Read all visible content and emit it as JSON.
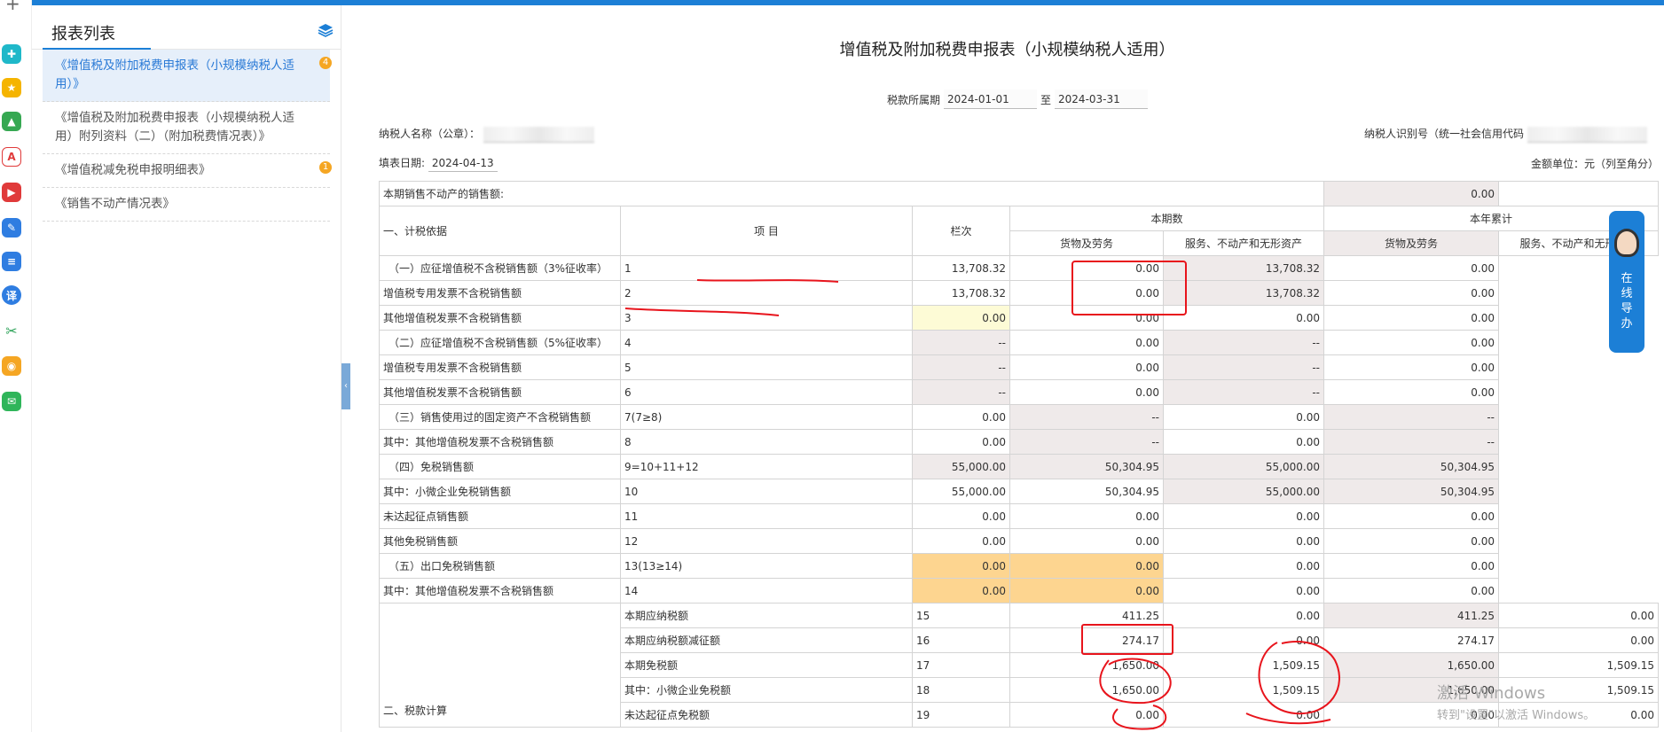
{
  "sidebar": {
    "title": "报表列表",
    "items": [
      {
        "label": "《增值税及附加税费申报表（小规模纳税人适用）》",
        "badge": "4"
      },
      {
        "label": "《增值税及附加税费申报表（小规模纳税人适用）附列资料（二）（附加税费情况表）》",
        "badge": ""
      },
      {
        "label": "《增值税减免税申报明细表》",
        "badge": "1"
      },
      {
        "label": "《销售不动产情况表》",
        "badge": ""
      }
    ]
  },
  "form": {
    "title": "增值税及附加税费申报表（小规模纳税人适用）",
    "period_label": "税款所属期",
    "period_from": "2024-01-01",
    "period_sep": "至",
    "period_to": "2024-03-31",
    "taxpayer_name_label": "纳税人名称（公章）：",
    "taxpayer_id_label": "纳税人识别号（统一社会信用代码",
    "fill_date_label": "填表日期:",
    "fill_date": "2024-04-13",
    "unit_label": "金额单位：元（列至角分）"
  },
  "table": {
    "row0_label": "本期销售不动产的销售额:",
    "row0_value": "0.00",
    "h_item": "项  目",
    "h_col": "栏次",
    "h_current": "本期数",
    "h_ytd": "本年累计",
    "h_goods": "货物及劳务",
    "h_services": "服务、不动产和无形资产",
    "section1": "一、计税依据",
    "section2": "二、税款计算",
    "rows": [
      {
        "label": "（一）应征增值税不含税销售额（3%征收率）",
        "col": "1",
        "c1": "13,708.32",
        "c2": "0.00",
        "y1": "13,708.32",
        "y2": "0.00"
      },
      {
        "label": "增值税专用发票不含税销售额",
        "col": "2",
        "c1": "13,708.32",
        "c2": "0.00",
        "y1": "13,708.32",
        "y2": "0.00"
      },
      {
        "label": "其他增值税发票不含税销售额",
        "col": "3",
        "c1": "0.00",
        "c2": "0.00",
        "y1": "0.00",
        "y2": "0.00"
      },
      {
        "label": "（二）应征增值税不含税销售额（5%征收率）",
        "col": "4",
        "c1": "--",
        "c2": "0.00",
        "y1": "--",
        "y2": "0.00"
      },
      {
        "label": "增值税专用发票不含税销售额",
        "col": "5",
        "c1": "--",
        "c2": "0.00",
        "y1": "--",
        "y2": "0.00"
      },
      {
        "label": "其他增值税发票不含税销售额",
        "col": "6",
        "c1": "--",
        "c2": "0.00",
        "y1": "--",
        "y2": "0.00"
      },
      {
        "label": "（三）销售使用过的固定资产不含税销售额",
        "col": "7(7≥8)",
        "c1": "0.00",
        "c2": "--",
        "y1": "0.00",
        "y2": "--"
      },
      {
        "label": "其中：其他增值税发票不含税销售额",
        "col": "8",
        "c1": "0.00",
        "c2": "--",
        "y1": "0.00",
        "y2": "--"
      },
      {
        "label": "（四）免税销售额",
        "col": "9=10+11+12",
        "c1": "55,000.00",
        "c2": "50,304.95",
        "y1": "55,000.00",
        "y2": "50,304.95"
      },
      {
        "label": "其中：小微企业免税销售额",
        "col": "10",
        "c1": "55,000.00",
        "c2": "50,304.95",
        "y1": "55,000.00",
        "y2": "50,304.95"
      },
      {
        "label": "未达起征点销售额",
        "col": "11",
        "c1": "0.00",
        "c2": "0.00",
        "y1": "0.00",
        "y2": "0.00"
      },
      {
        "label": "其他免税销售额",
        "col": "12",
        "c1": "0.00",
        "c2": "0.00",
        "y1": "0.00",
        "y2": "0.00"
      },
      {
        "label": "（五）出口免税销售额",
        "col": "13(13≥14)",
        "c1": "0.00",
        "c2": "0.00",
        "y1": "0.00",
        "y2": "0.00"
      },
      {
        "label": "其中：其他增值税发票不含税销售额",
        "col": "14",
        "c1": "0.00",
        "c2": "0.00",
        "y1": "0.00",
        "y2": "0.00"
      },
      {
        "label": "本期应纳税额",
        "col": "15",
        "c1": "411.25",
        "c2": "0.00",
        "y1": "411.25",
        "y2": "0.00"
      },
      {
        "label": "本期应纳税额减征额",
        "col": "16",
        "c1": "274.17",
        "c2": "0.00",
        "y1": "274.17",
        "y2": "0.00"
      },
      {
        "label": "本期免税额",
        "col": "17",
        "c1": "1,650.00",
        "c2": "1,509.15",
        "y1": "1,650.00",
        "y2": "1,509.15"
      },
      {
        "label": "其中：小微企业免税额",
        "col": "18",
        "c1": "1,650.00",
        "c2": "1,509.15",
        "y1": "1,650.00",
        "y2": "1,509.15"
      },
      {
        "label": "未达起征点免税额",
        "col": "19",
        "c1": "0.00",
        "c2": "0.00",
        "y1": "0.00",
        "y2": "0.00"
      }
    ]
  },
  "help": {
    "text": "在线导办"
  },
  "watermark": {
    "line1": "激活 Windows",
    "line2": "转到\"设置\"以激活 Windows。"
  },
  "icons": [
    "plus-icon",
    "network-icon",
    "star-icon",
    "image-ai-icon",
    "pdf-ai-icon",
    "video-ai-icon",
    "edit-ai-icon",
    "doc-ai-icon",
    "translate-icon",
    "scissors-icon",
    "weibo-icon",
    "mail-icon",
    "layers-icon"
  ],
  "colors": {
    "accent": "#1c7fd6",
    "annotation": "#e8141c",
    "highlight_orange": "#fdd590",
    "readonly_gray": "#efeaea"
  }
}
